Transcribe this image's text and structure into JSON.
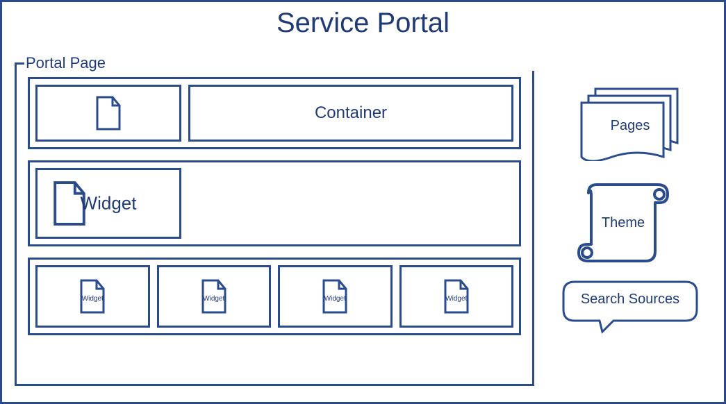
{
  "title": "Service Portal",
  "page_label": "Portal Page",
  "rows": {
    "first": {
      "container_label": "Container"
    },
    "second": {
      "widget_label": "Widget"
    },
    "third": {
      "widgets": [
        "Widget",
        "Widget",
        "Widget",
        "Widget"
      ]
    }
  },
  "side": {
    "pages": "Pages",
    "theme": "Theme",
    "search": "Search Sources"
  }
}
